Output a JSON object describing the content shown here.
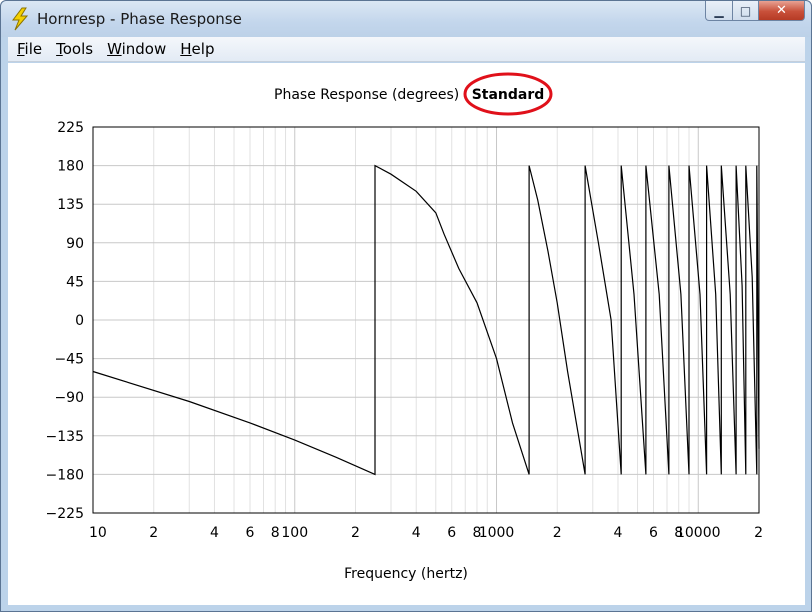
{
  "window": {
    "title": "Hornresp - Phase Response",
    "controls": {
      "minimize": "▁",
      "maximize": "□",
      "close": "✕"
    }
  },
  "menu": {
    "items": [
      {
        "first": "F",
        "rest": "ile"
      },
      {
        "first": "T",
        "rest": "ools"
      },
      {
        "first": "W",
        "rest": "indow"
      },
      {
        "first": "H",
        "rest": "elp"
      }
    ]
  },
  "plot": {
    "title": "Phase Response (degrees)",
    "mode_label": "Standard",
    "highlight_color": "#e0101a",
    "xlabel": "Frequency (hertz)"
  },
  "chart_data": {
    "type": "line",
    "title": "Phase Response (degrees)",
    "xlabel": "Frequency (hertz)",
    "ylabel": "",
    "x_scale": "log",
    "xlim": [
      10,
      20000
    ],
    "ylim": [
      -225,
      225
    ],
    "grid": true,
    "yticks": [
      225,
      180,
      135,
      90,
      45,
      0,
      -45,
      -90,
      -135,
      -180,
      -225
    ],
    "ytick_labels": [
      "225",
      "180",
      "135",
      "90",
      "45",
      "0",
      "−45",
      "−90",
      "−135",
      "−180",
      "−225"
    ],
    "xticks": [
      {
        "value": 10,
        "label": "10"
      },
      {
        "value": 20,
        "label": "2"
      },
      {
        "value": 40,
        "label": "4"
      },
      {
        "value": 60,
        "label": "6"
      },
      {
        "value": 80,
        "label": "8"
      },
      {
        "value": 100,
        "label": "100"
      },
      {
        "value": 200,
        "label": "2"
      },
      {
        "value": 400,
        "label": "4"
      },
      {
        "value": 600,
        "label": "6"
      },
      {
        "value": 800,
        "label": "8"
      },
      {
        "value": 1000,
        "label": "1000"
      },
      {
        "value": 2000,
        "label": "2"
      },
      {
        "value": 4000,
        "label": "4"
      },
      {
        "value": 6000,
        "label": "6"
      },
      {
        "value": 8000,
        "label": "8"
      },
      {
        "value": 10000,
        "label": "10000"
      },
      {
        "value": 20000,
        "label": "2"
      }
    ],
    "series": [
      {
        "x": [
          10,
          30,
          60,
          100,
          160,
          250,
          250,
          300,
          400,
          500,
          550,
          650,
          800,
          1000,
          1200,
          1450,
          1450,
          1600,
          1800,
          2000,
          2250,
          2750,
          2750,
          3200,
          3700,
          4150,
          4150,
          4800,
          5500,
          5500,
          6400,
          7150,
          7150,
          8200,
          9000,
          9000,
          10200,
          11000,
          11000,
          12200,
          13000,
          13000,
          14400,
          15400,
          15400,
          16500,
          17200,
          17200,
          18500,
          19500,
          19500,
          20000
        ],
        "y": [
          -60,
          -95,
          -120,
          -140,
          -160,
          -180,
          180,
          170,
          150,
          125,
          100,
          60,
          20,
          -45,
          -120,
          -180,
          180,
          140,
          80,
          20,
          -60,
          -180,
          180,
          90,
          0,
          -180,
          180,
          30,
          -180,
          180,
          30,
          -180,
          180,
          30,
          -180,
          180,
          30,
          -180,
          180,
          30,
          -180,
          180,
          30,
          -180,
          180,
          40,
          -180,
          180,
          50,
          -180,
          180,
          -150
        ]
      }
    ]
  }
}
